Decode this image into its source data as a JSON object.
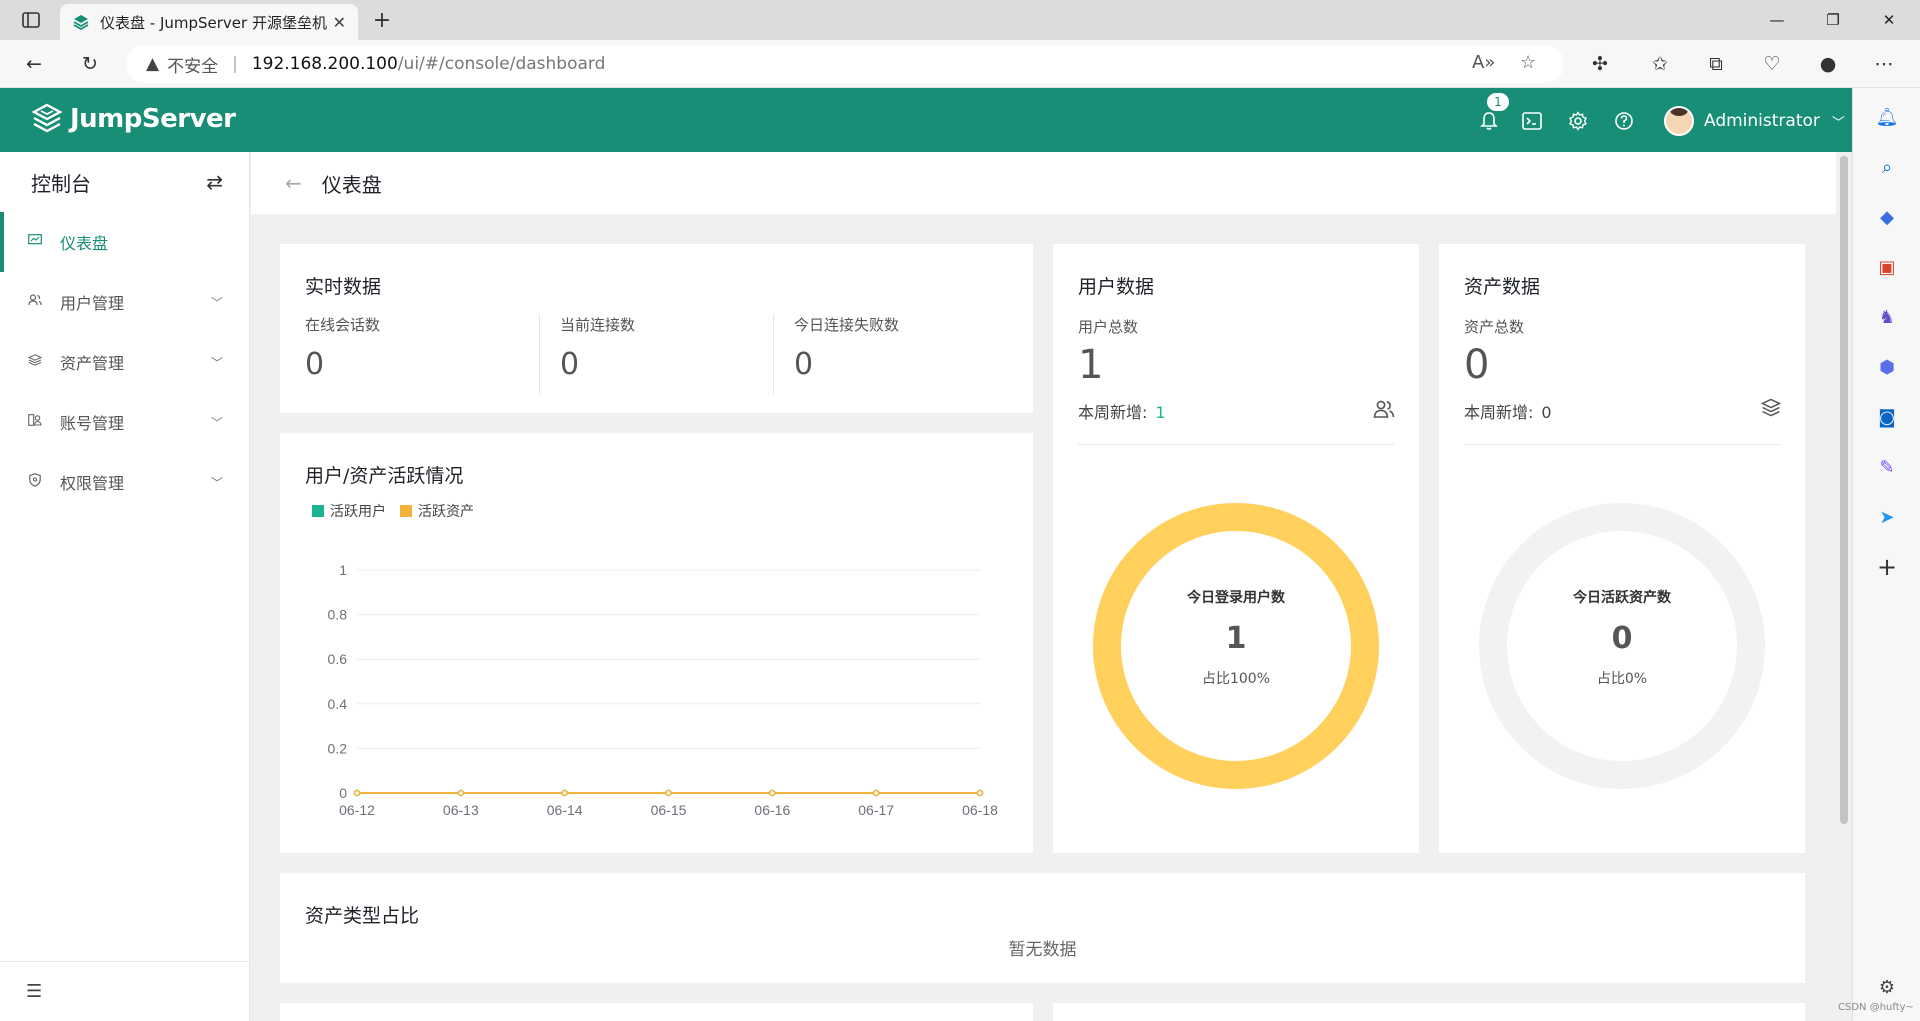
{
  "browser": {
    "tab_title": "仪表盘 - JumpServer 开源堡垒机",
    "insecure_label": "不安全",
    "url_host": "192.168.200.100",
    "url_path": "/ui/#/console/dashboard"
  },
  "header": {
    "logo_text": "JumpServer",
    "notification_count": "1",
    "username": "Administrator",
    "brand_color": "#178e75"
  },
  "sidebar": {
    "title": "控制台",
    "items": [
      {
        "label": "仪表盘",
        "icon": "monitor-chart-icon"
      },
      {
        "label": "用户管理",
        "icon": "users-icon"
      },
      {
        "label": "资产管理",
        "icon": "layers-icon"
      },
      {
        "label": "账号管理",
        "icon": "account-icon"
      },
      {
        "label": "权限管理",
        "icon": "shield-icon"
      }
    ]
  },
  "breadcrumb": {
    "title": "仪表盘"
  },
  "realtime": {
    "title": "实时数据",
    "stats": [
      {
        "label": "在线会话数",
        "value": "0"
      },
      {
        "label": "当前连接数",
        "value": "0"
      },
      {
        "label": "今日连接失败数",
        "value": "0"
      }
    ]
  },
  "activity": {
    "title": "用户/资产活跃情况",
    "legend": [
      "活跃用户",
      "活跃资产"
    ],
    "colors": [
      "#1ab394",
      "#f4b13c"
    ]
  },
  "chart_data": {
    "type": "line",
    "categories": [
      "06-12",
      "06-13",
      "06-14",
      "06-15",
      "06-16",
      "06-17",
      "06-18"
    ],
    "series": [
      {
        "name": "活跃用户",
        "values": [
          0,
          0,
          0,
          0,
          0,
          0,
          0
        ]
      },
      {
        "name": "活跃资产",
        "values": [
          0,
          0,
          0,
          0,
          0,
          0,
          0
        ]
      }
    ],
    "yticks": [
      "0",
      "0.2",
      "0.4",
      "0.6",
      "0.8",
      "1"
    ],
    "ylim": [
      0,
      1
    ],
    "grid": true,
    "legend_position": "top-left"
  },
  "users": {
    "title": "用户数据",
    "total_label": "用户总数",
    "total": "1",
    "new_label": "本周新增:",
    "new_value": "1",
    "donut_title": "今日登录用户数",
    "donut_value": "1",
    "donut_ratio": "占比100%",
    "donut_fraction": 1.0,
    "donut_color": "#ffd05c"
  },
  "assets": {
    "title": "资产数据",
    "total_label": "资产总数",
    "total": "0",
    "new_label": "本周新增:",
    "new_value": "0",
    "donut_title": "今日活跃资产数",
    "donut_value": "0",
    "donut_ratio": "占比0%",
    "donut_fraction": 0.0,
    "donut_color": "#f0f3f2"
  },
  "asset_types": {
    "title": "资产类型占比",
    "empty": "暂无数据"
  },
  "watermark": "CSDN @hufty~"
}
